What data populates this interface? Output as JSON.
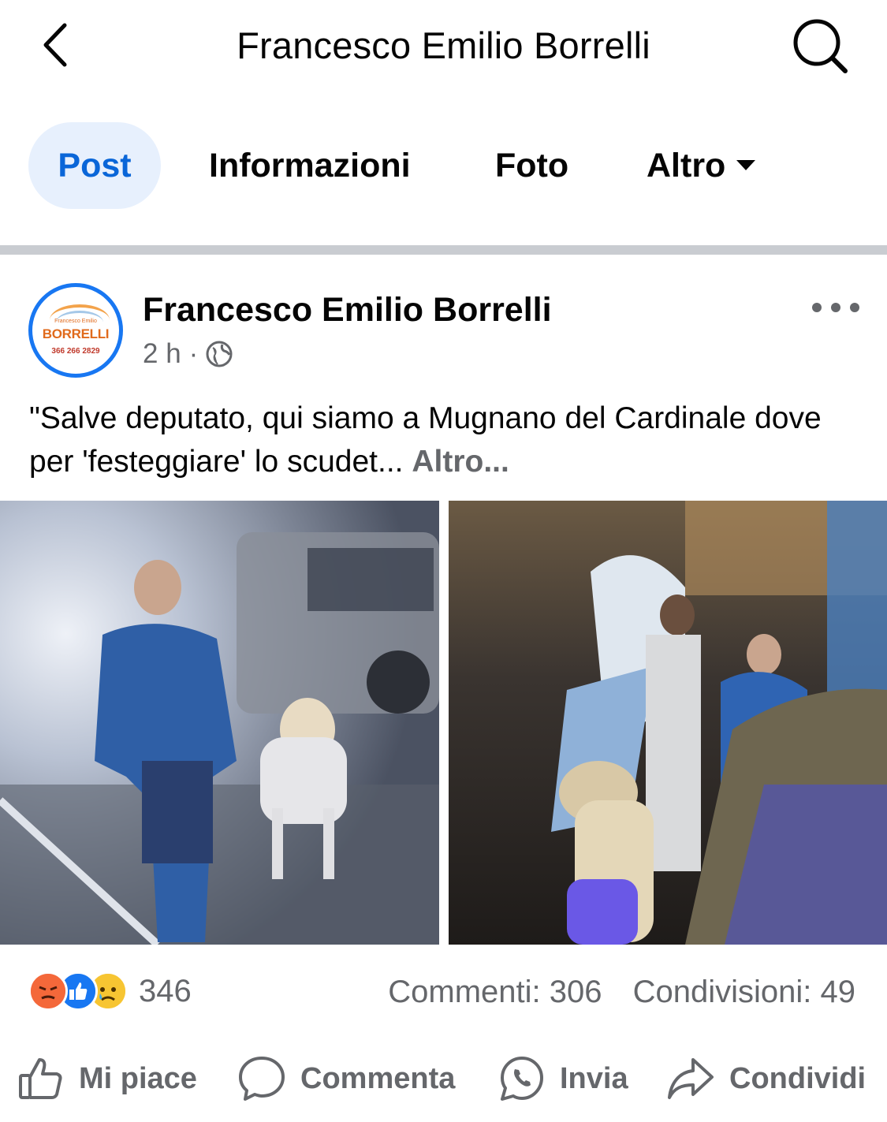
{
  "header": {
    "title": "Francesco Emilio Borrelli",
    "back_icon": "chevron-left-icon",
    "search_icon": "search-icon"
  },
  "tabs": [
    {
      "label": "Post",
      "active": true
    },
    {
      "label": "Informazioni",
      "active": false
    },
    {
      "label": "Foto",
      "active": false
    },
    {
      "label": "Altro",
      "active": false
    }
  ],
  "post": {
    "author": "Francesco Emilio Borrelli",
    "avatar": {
      "small_text": "Francesco Emilio",
      "logo_text": "BORRELLI",
      "phone": "366 266 2829"
    },
    "time": "2 h",
    "separator": "·",
    "privacy_icon": "globe-icon",
    "text": "\"Salve deputato, qui siamo a Mugnano del Cardinale dove per 'festeggiare' lo scudet...",
    "see_more": "Altro...",
    "photos": [
      {
        "description_icon": "photo-icon"
      },
      {
        "description_icon": "photo-icon"
      }
    ]
  },
  "stats": {
    "reactions": [
      "angry-reaction-icon",
      "like-reaction-icon",
      "sad-reaction-icon"
    ],
    "reaction_count": "346",
    "comments": "Commenti: 306",
    "shares": "Condivisioni: 49"
  },
  "actions": {
    "like": "Mi piace",
    "comment": "Commenta",
    "send": "Invia",
    "share": "Condividi"
  },
  "colors": {
    "accent": "#0a66d8",
    "active_tab_bg": "#e7f0fd",
    "avatar_ring": "#1877f2",
    "secondary_text": "#65676b",
    "divider": "#c9ccd1"
  }
}
